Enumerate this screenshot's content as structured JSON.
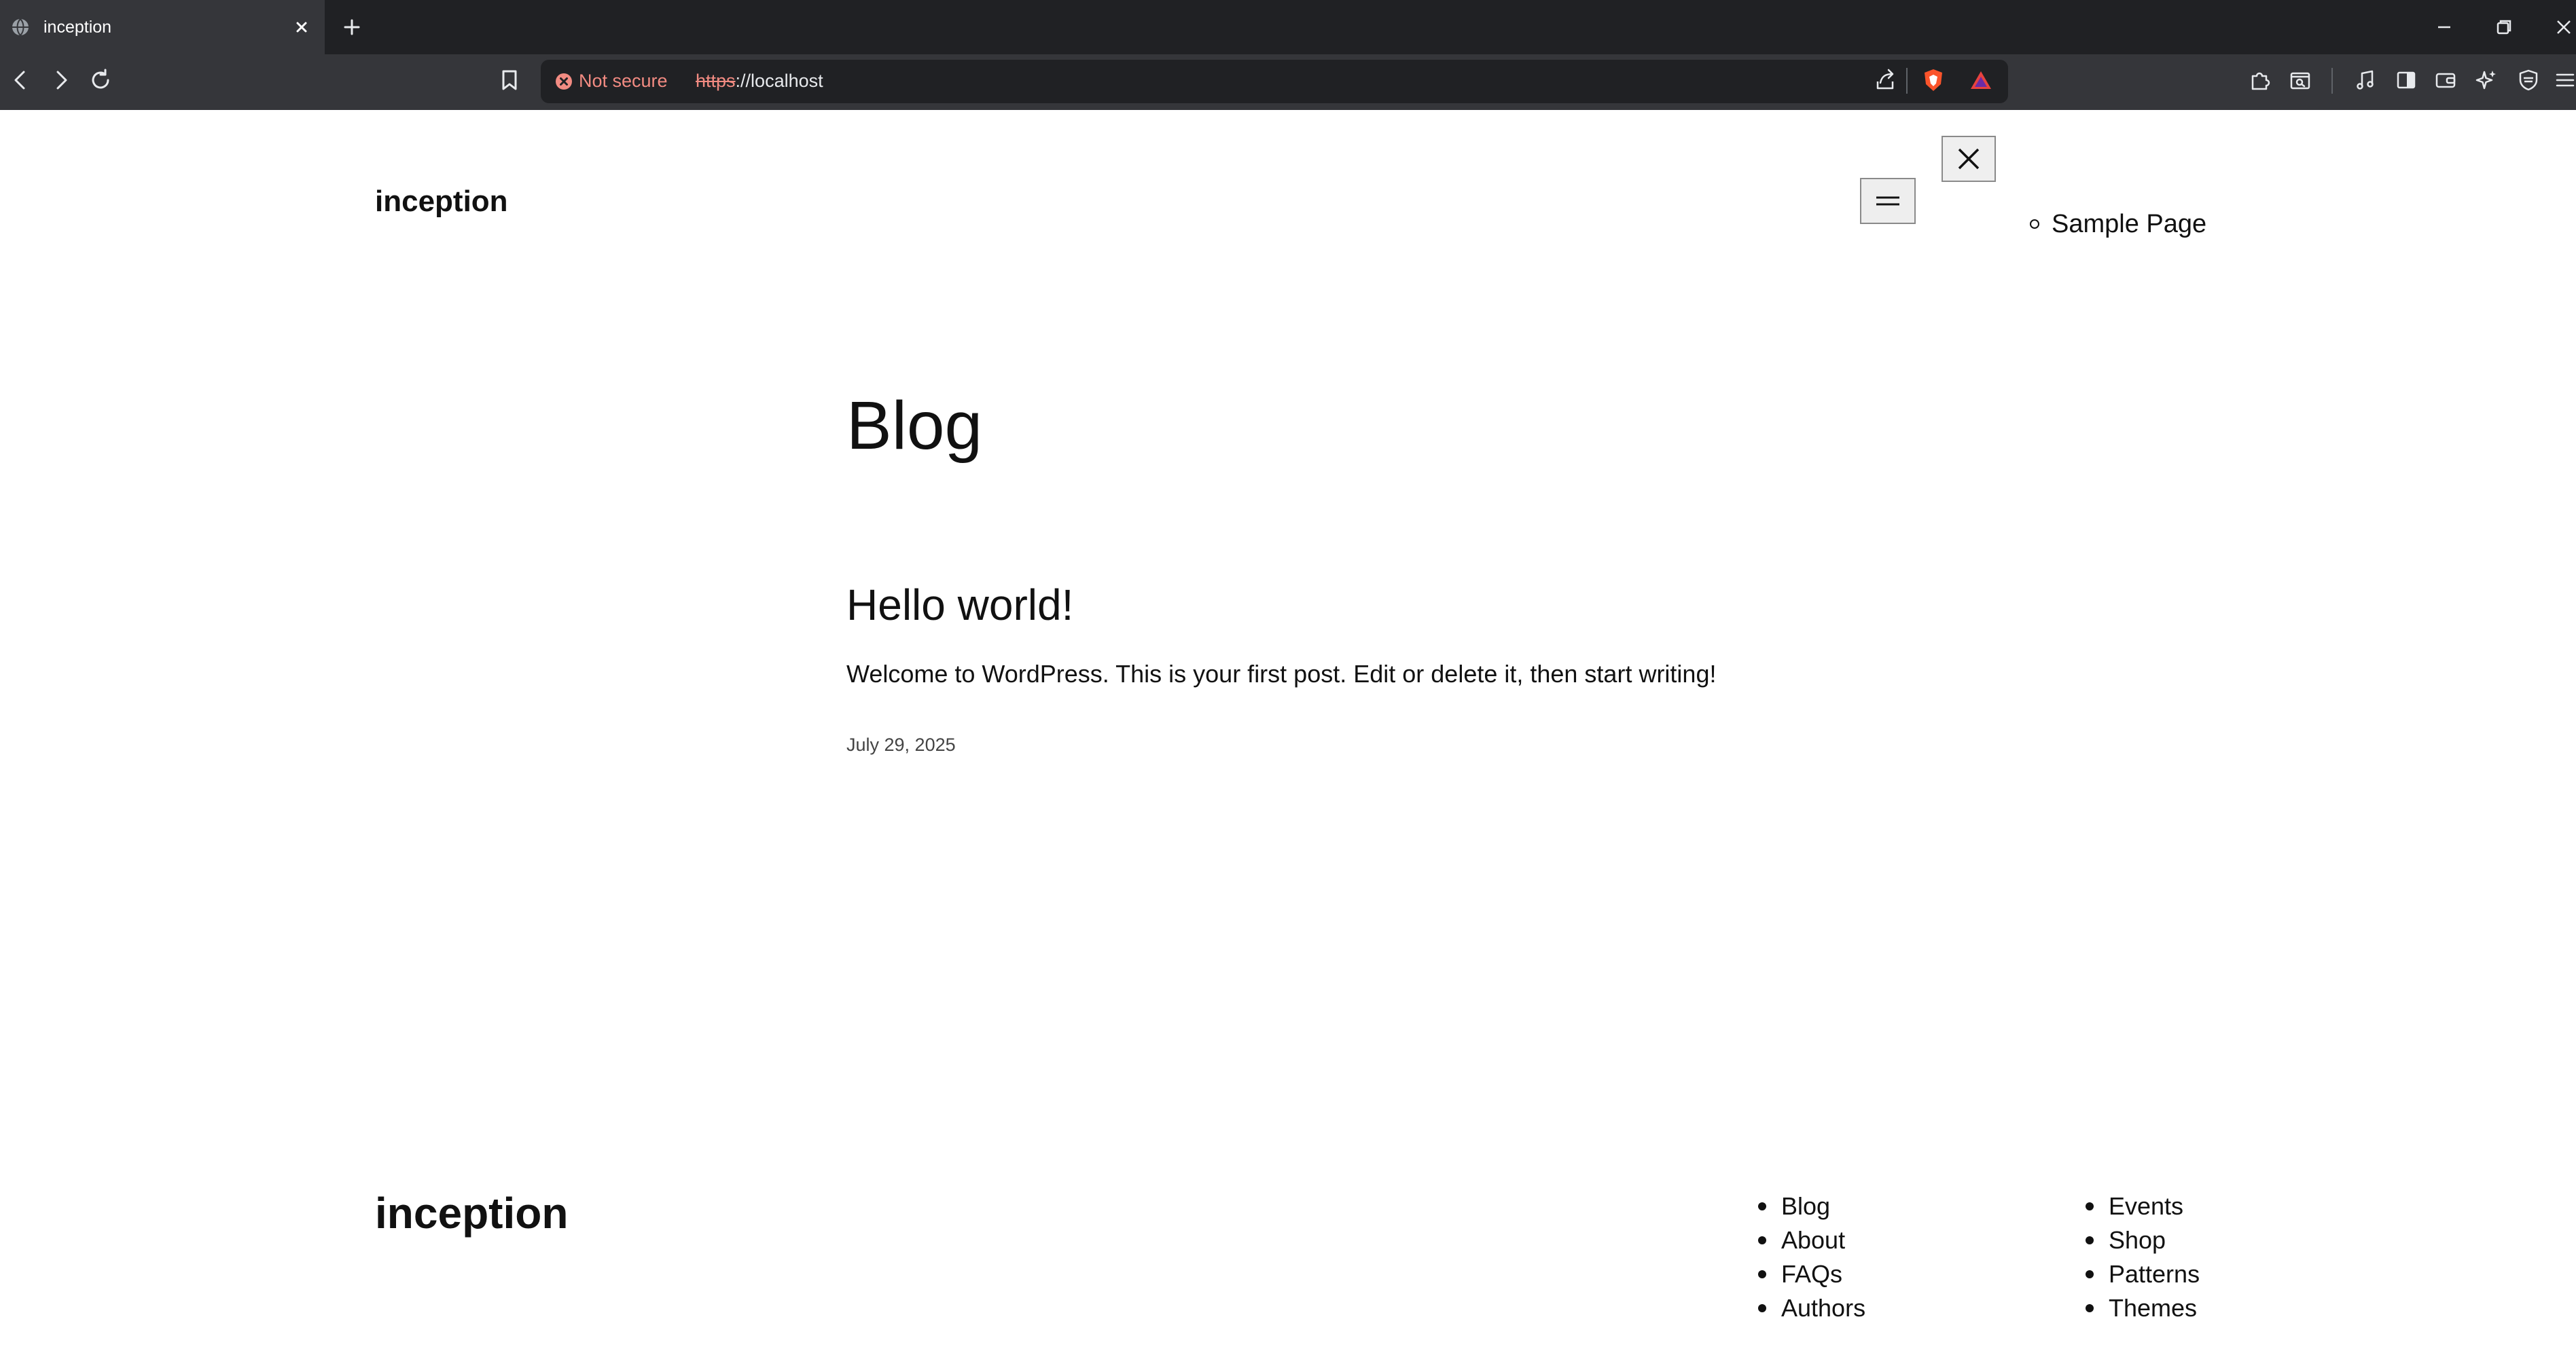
{
  "browser": {
    "tab": {
      "title": "inception",
      "favicon": "globe-icon"
    },
    "omnibox": {
      "security_label": "Not secure",
      "url_scheme": "https",
      "url_rest": "://localhost"
    },
    "icons": [
      "back-arrow-icon",
      "forward-arrow-icon",
      "reload-icon",
      "bookmark-icon",
      "share-icon",
      "brave-shields-icon",
      "brave-rewards-icon",
      "extensions-icon",
      "tab-search-icon",
      "media-icon",
      "sidebar-icon",
      "wallet-icon",
      "leo-ai-icon",
      "vpn-icon",
      "menu-icon"
    ],
    "colors": {
      "frame": "#202124",
      "toolbar": "#35363a",
      "warning": "#f28b82"
    }
  },
  "header": {
    "site_title": "inception",
    "nav_items": [
      "Sample Page"
    ]
  },
  "main": {
    "heading": "Blog",
    "post": {
      "title": "Hello world!",
      "excerpt": "Welcome to WordPress. This is your first post. Edit or delete it, then start writing!",
      "date": "July 29, 2025"
    }
  },
  "footer": {
    "site_title": "inception",
    "col1": [
      "Blog",
      "About",
      "FAQs",
      "Authors"
    ],
    "col2": [
      "Events",
      "Shop",
      "Patterns",
      "Themes"
    ]
  }
}
